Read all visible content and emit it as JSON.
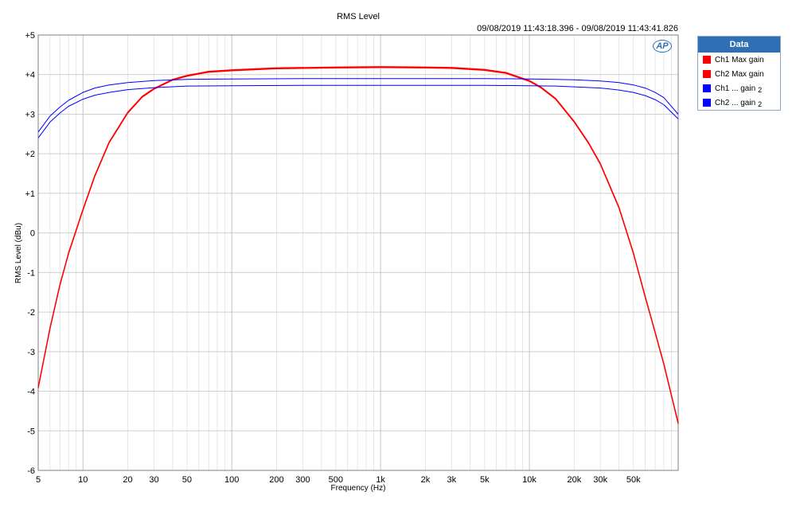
{
  "chart_data": {
    "type": "line",
    "title": "RMS Level",
    "timestamp": "09/08/2019 11:43:18.396 - 09/08/2019 11:43:41.826",
    "xlabel": "Frequency (Hz)",
    "ylabel": "RMS Level (dBu)",
    "xscale": "log",
    "xlim": [
      5,
      100000
    ],
    "ylim": [
      -6,
      5
    ],
    "grid": true,
    "legend_position": "right",
    "x_ticks": [
      {
        "value": 5,
        "label": "5"
      },
      {
        "value": 10,
        "label": "10"
      },
      {
        "value": 20,
        "label": "20"
      },
      {
        "value": 30,
        "label": "30"
      },
      {
        "value": 50,
        "label": "50"
      },
      {
        "value": 100,
        "label": "100"
      },
      {
        "value": 200,
        "label": "200"
      },
      {
        "value": 300,
        "label": "300"
      },
      {
        "value": 500,
        "label": "500"
      },
      {
        "value": 1000,
        "label": "1k"
      },
      {
        "value": 2000,
        "label": "2k"
      },
      {
        "value": 3000,
        "label": "3k"
      },
      {
        "value": 5000,
        "label": "5k"
      },
      {
        "value": 10000,
        "label": "10k"
      },
      {
        "value": 20000,
        "label": "20k"
      },
      {
        "value": 30000,
        "label": "30k"
      },
      {
        "value": 50000,
        "label": "50k"
      }
    ],
    "y_ticks": [
      {
        "value": 5,
        "label": "+5"
      },
      {
        "value": 4,
        "label": "+4"
      },
      {
        "value": 3,
        "label": "+3"
      },
      {
        "value": 2,
        "label": "+2"
      },
      {
        "value": 1,
        "label": "+1"
      },
      {
        "value": 0,
        "label": "0"
      },
      {
        "value": -1,
        "label": "-1"
      },
      {
        "value": -2,
        "label": "-2"
      },
      {
        "value": -3,
        "label": "-3"
      },
      {
        "value": -4,
        "label": "-4"
      },
      {
        "value": -5,
        "label": "-5"
      },
      {
        "value": -6,
        "label": "-6"
      }
    ],
    "series": [
      {
        "name": "Ch1 Max gain",
        "color": "#ff0000",
        "x": [
          5,
          6,
          7,
          8,
          10,
          12,
          15,
          20,
          25,
          30,
          40,
          50,
          70,
          100,
          200,
          500,
          1000,
          2000,
          3000,
          5000,
          7000,
          10000,
          12000,
          15000,
          20000,
          25000,
          30000,
          40000,
          50000,
          60000,
          70000,
          80000,
          100000
        ],
        "y": [
          -3.9,
          -2.4,
          -1.3,
          -0.5,
          0.6,
          1.45,
          2.3,
          3.05,
          3.45,
          3.65,
          3.88,
          3.98,
          4.08,
          4.12,
          4.17,
          4.19,
          4.2,
          4.19,
          4.18,
          4.13,
          4.05,
          3.85,
          3.68,
          3.4,
          2.82,
          2.28,
          1.75,
          0.65,
          -0.5,
          -1.6,
          -2.5,
          -3.3,
          -4.8
        ]
      },
      {
        "name": "Ch2 Max gain",
        "color": "#ff0000",
        "x": [
          5,
          6,
          7,
          8,
          10,
          12,
          15,
          20,
          25,
          30,
          40,
          50,
          70,
          100,
          200,
          500,
          1000,
          2000,
          3000,
          5000,
          7000,
          10000,
          12000,
          15000,
          20000,
          25000,
          30000,
          40000,
          50000,
          60000,
          70000,
          80000,
          100000
        ],
        "y": [
          -3.92,
          -2.42,
          -1.32,
          -0.52,
          0.58,
          1.43,
          2.28,
          3.03,
          3.43,
          3.63,
          3.86,
          3.96,
          4.06,
          4.1,
          4.15,
          4.17,
          4.18,
          4.17,
          4.16,
          4.11,
          4.03,
          3.83,
          3.66,
          3.38,
          2.8,
          2.26,
          1.73,
          0.63,
          -0.52,
          -1.62,
          -2.52,
          -3.32,
          -4.82
        ]
      },
      {
        "name": "Ch1 ... gain",
        "name_subscript": "2",
        "color": "#0000ff",
        "x": [
          5,
          6,
          7,
          8,
          10,
          12,
          15,
          20,
          30,
          50,
          100,
          300,
          1000,
          3000,
          5000,
          10000,
          15000,
          20000,
          30000,
          40000,
          50000,
          60000,
          70000,
          80000,
          100000
        ],
        "y": [
          2.55,
          2.95,
          3.18,
          3.35,
          3.55,
          3.66,
          3.74,
          3.8,
          3.85,
          3.88,
          3.89,
          3.9,
          3.9,
          3.9,
          3.9,
          3.89,
          3.88,
          3.87,
          3.84,
          3.8,
          3.74,
          3.66,
          3.55,
          3.42,
          3.0
        ]
      },
      {
        "name": "Ch2 ... gain",
        "name_subscript": "2",
        "color": "#0000ff",
        "x": [
          5,
          6,
          7,
          8,
          10,
          12,
          15,
          20,
          30,
          50,
          100,
          300,
          1000,
          3000,
          5000,
          10000,
          15000,
          20000,
          30000,
          40000,
          50000,
          60000,
          70000,
          80000,
          100000
        ],
        "y": [
          2.4,
          2.8,
          3.03,
          3.2,
          3.38,
          3.48,
          3.55,
          3.62,
          3.67,
          3.71,
          3.72,
          3.73,
          3.73,
          3.73,
          3.73,
          3.72,
          3.71,
          3.69,
          3.66,
          3.61,
          3.55,
          3.47,
          3.37,
          3.24,
          2.88
        ]
      }
    ]
  },
  "legend": {
    "title": "Data"
  },
  "logo": {
    "text": "AP"
  }
}
